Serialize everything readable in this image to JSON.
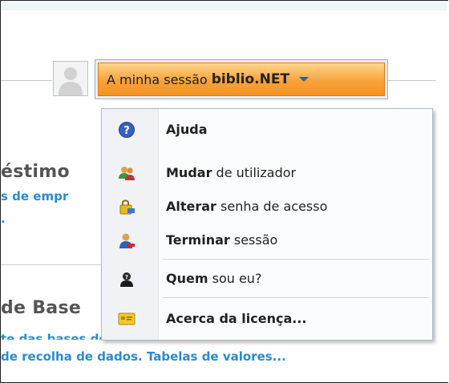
{
  "background": {
    "heading1": "éstimo",
    "link1": "s de empr",
    "link1_dot": ".",
    "heading2": "de Base",
    "link2": "te das bases de dados. Campos e",
    "link3": "de recolha de dados. Tabelas de valores..."
  },
  "session": {
    "prefix": "A minha sessão",
    "app_name": "biblio.NET"
  },
  "menu": {
    "items": [
      {
        "bold": "Ajuda",
        "rest": "",
        "icon": "help-icon"
      },
      {
        "bold": "Mudar",
        "rest": " de utilizador",
        "icon": "switch-user-icon"
      },
      {
        "bold": "Alterar",
        "rest": " senha de acesso",
        "icon": "lock-password-icon"
      },
      {
        "bold": "Terminar",
        "rest": " sessão",
        "icon": "logout-user-icon"
      },
      {
        "bold": "Quem",
        "rest": " sou eu?",
        "icon": "anonymous-user-icon"
      },
      {
        "bold": "Acerca da licença...",
        "rest": "",
        "icon": "license-card-icon"
      }
    ]
  },
  "colors": {
    "accent_orange": "#f39322",
    "link_blue": "#2a8ad4"
  }
}
